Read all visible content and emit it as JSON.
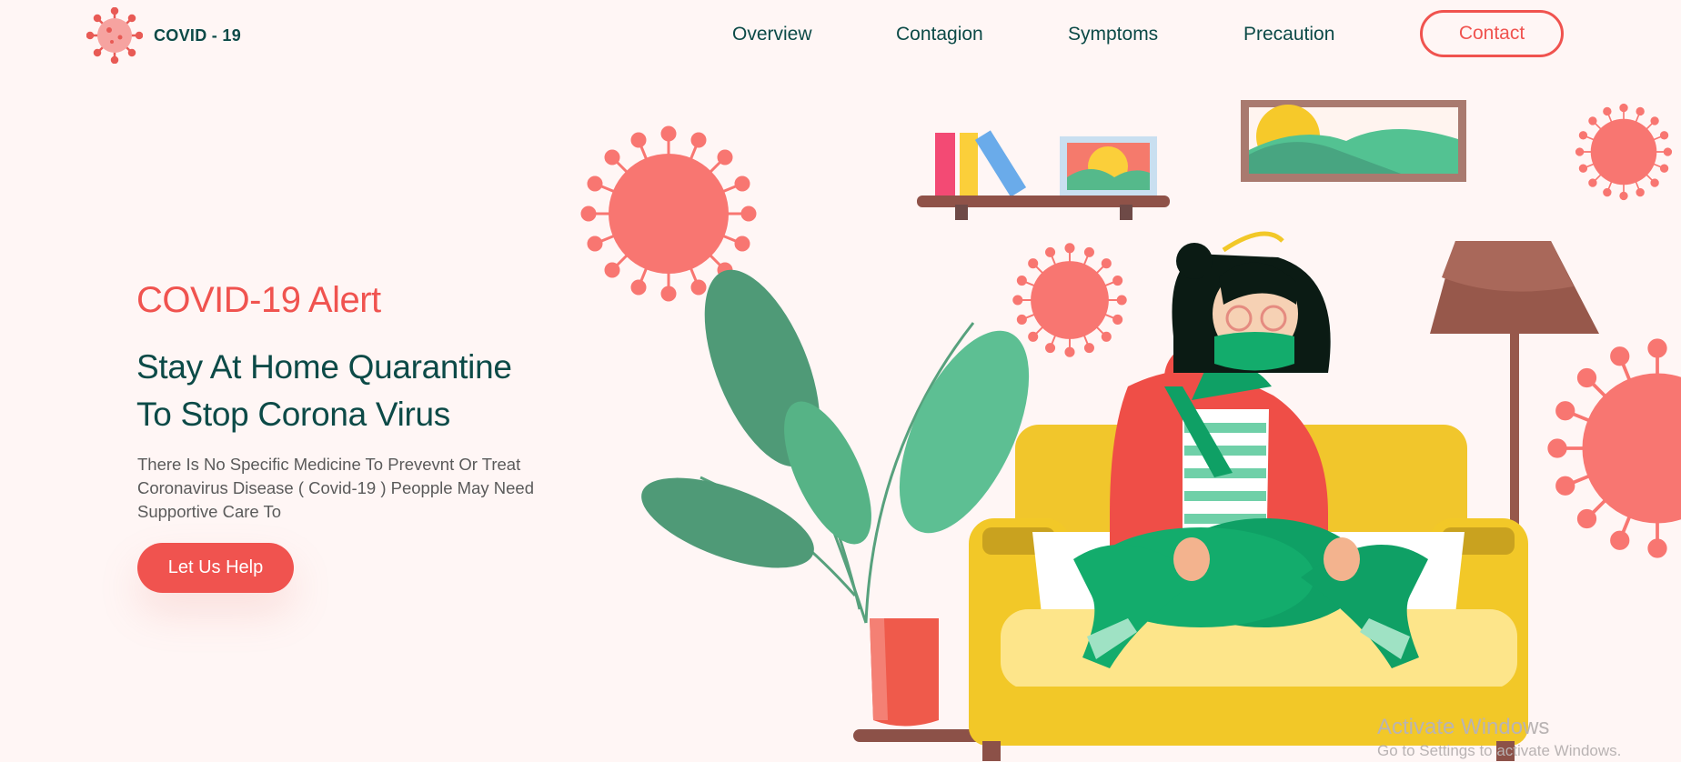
{
  "brand": {
    "name": "COVID - 19",
    "logo_icon": "virus-icon"
  },
  "nav": {
    "items": [
      "Overview",
      "Contagion",
      "Symptoms",
      "Precaution"
    ],
    "contact_label": "Contact"
  },
  "hero": {
    "alert": "COVID-19 Alert",
    "headline_line1": "Stay At Home Quarantine",
    "headline_line2": "To Stop Corona Virus",
    "description": "There Is No Specific Medicine To Prevevnt Or Treat Coronavirus Disease ( Covid-19 ) Peopple May Need Supportive Care To",
    "cta_label": "Let Us Help"
  },
  "colors": {
    "accent": "#f0534f",
    "heading": "#0c4a47",
    "background": "#fff6f5",
    "virus": "#f87671",
    "sofa": "#f2c828",
    "plant": "#5aa884"
  },
  "watermark": {
    "title": "Activate Windows",
    "subtitle": "Go to Settings to activate Windows."
  }
}
